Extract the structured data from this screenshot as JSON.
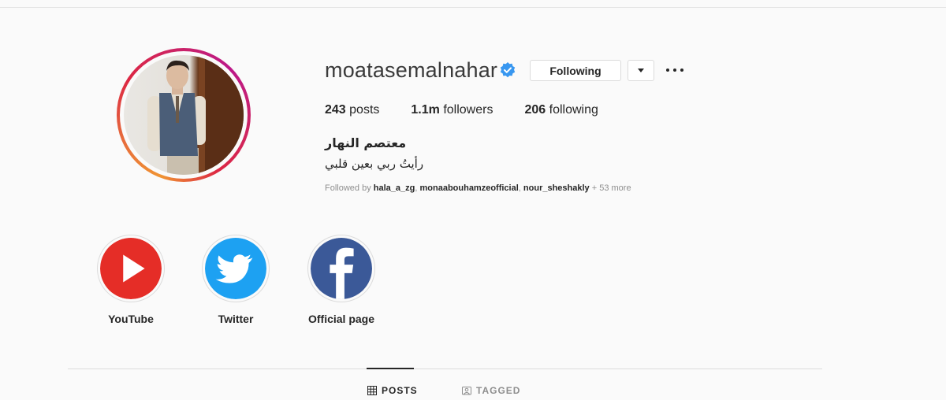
{
  "profile": {
    "username": "moatasemalnahar",
    "verified": true,
    "following_button": "Following",
    "stats": {
      "posts_count": "243",
      "posts_label": "posts",
      "followers_count": "1.1m",
      "followers_label": "followers",
      "following_count": "206",
      "following_label": "following"
    },
    "full_name": "معتصم النهار",
    "bio": "رأيتُ ربي بعين قلبي",
    "followed_by": {
      "prefix": "Followed by",
      "accounts": [
        "hala_a_zg",
        "monaabouhamzeofficial",
        "nour_sheshakly"
      ],
      "more": "+ 53 more"
    }
  },
  "highlights": [
    {
      "label": "YouTube",
      "icon": "youtube-play-icon",
      "color": "#e52d27"
    },
    {
      "label": "Twitter",
      "icon": "twitter-bird-icon",
      "color": "#1da1f2"
    },
    {
      "label": "Official page",
      "icon": "facebook-f-icon",
      "color": "#3b5998"
    }
  ],
  "tabs": [
    {
      "label": "POSTS",
      "icon": "grid-icon",
      "active": true
    },
    {
      "label": "TAGGED",
      "icon": "tag-icon",
      "active": false
    }
  ],
  "colors": {
    "verified_blue": "#3897f0",
    "text": "#262626",
    "muted": "#8e8e8e",
    "border": "#dbdbdb",
    "background": "#fafafa"
  }
}
